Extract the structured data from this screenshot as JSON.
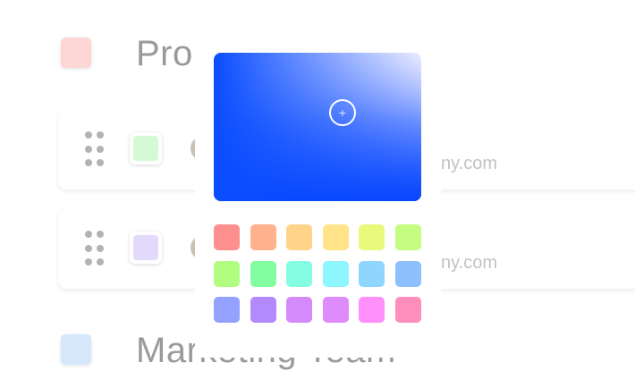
{
  "groups": [
    {
      "title": "Pro",
      "color": "#fdd6d6"
    },
    {
      "title": "Marketing Team",
      "color": "#d4e7fb"
    }
  ],
  "rows": [
    {
      "color": "#d3fad5",
      "email": "ny.com"
    },
    {
      "color": "#e3d9fb",
      "email": "ny.com"
    }
  ],
  "picker": {
    "gradient_hue": "#0a4dff",
    "cursor_glyph": "+",
    "swatches": [
      "#fe8f8f",
      "#ffb28d",
      "#ffd38a",
      "#ffe48a",
      "#e9f97c",
      "#c4fd7f",
      "#b1fd80",
      "#82fd9f",
      "#85fde2",
      "#8ef6fe",
      "#8fd6fe",
      "#8fc0fe",
      "#95a1fe",
      "#b28afd",
      "#d58afb",
      "#de8cfc",
      "#fe8ffb",
      "#fe8fba"
    ]
  }
}
